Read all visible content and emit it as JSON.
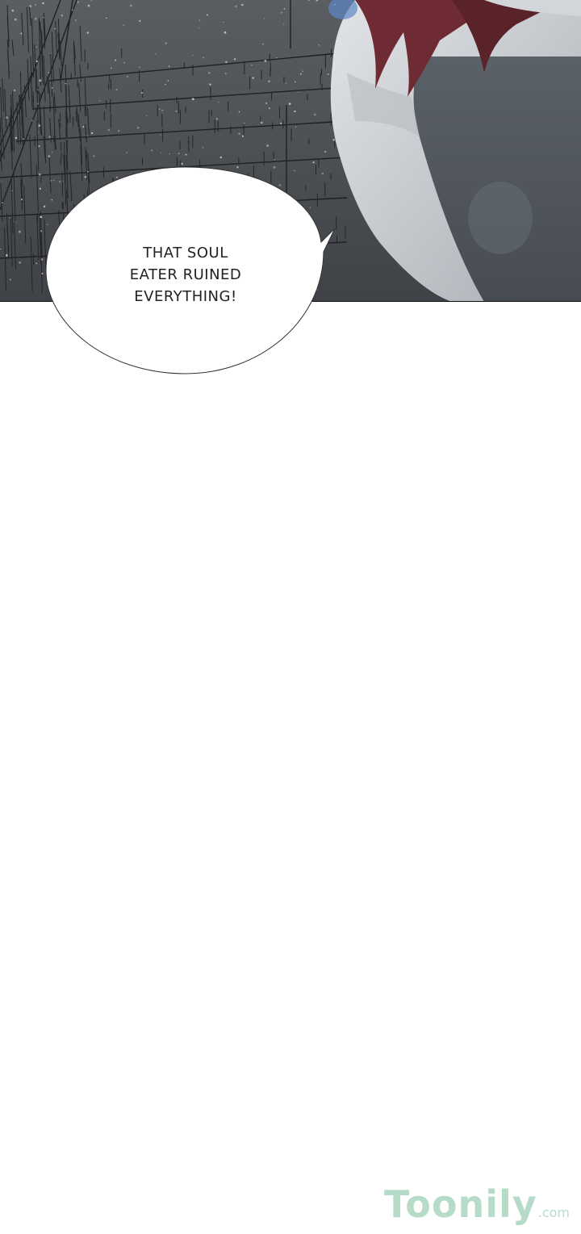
{
  "dialogue": {
    "lines": [
      "THAT SOUL",
      "EATER RUINED",
      "EVERYTHING!"
    ]
  },
  "watermark": {
    "name": "Toonily",
    "suffix": ".com",
    "color": "#b6dcc9"
  },
  "colors": {
    "background": "#ffffff",
    "panel_sky": "#4b4e52",
    "hair": "#6e2b33",
    "skin": "#c9ccd1",
    "shirt": "#545a62"
  }
}
